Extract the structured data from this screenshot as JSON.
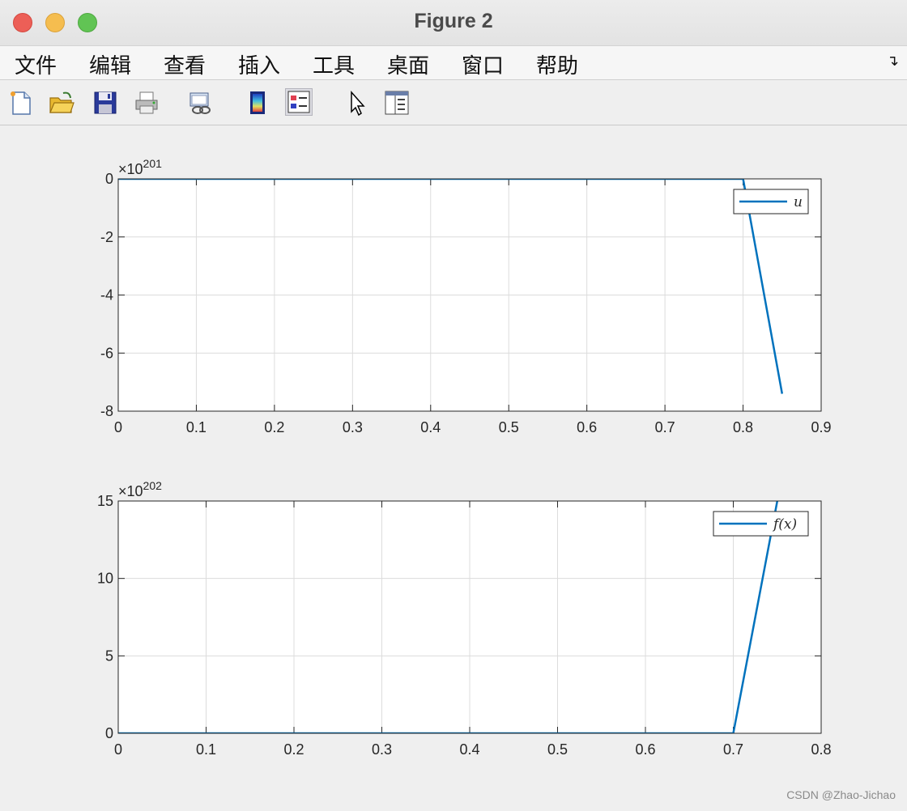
{
  "window": {
    "title": "Figure 2"
  },
  "menu": [
    "文件",
    "编辑",
    "查看",
    "插入",
    "工具",
    "桌面",
    "窗口",
    "帮助"
  ],
  "menu_overflow_icon": "overflow-arrow-icon",
  "toolbar": [
    "new-figure-icon",
    "open-file-icon",
    "save-icon",
    "print-icon",
    "link-plot-icon",
    "colorbar-icon",
    "legend-icon",
    "pointer-icon",
    "property-inspector-icon"
  ],
  "watermark": "CSDN @Zhao-Jichao",
  "colors": {
    "line": "#0072bd",
    "grid": "#dcdcdc",
    "bg": "#efefef"
  },
  "chart_data": [
    {
      "type": "line",
      "title": "",
      "xlabel": "",
      "ylabel": "",
      "exponent_label": "×10",
      "exponent": "201",
      "xlim": [
        0,
        0.9
      ],
      "ylim": [
        -8,
        0
      ],
      "xticks": [
        "0",
        "0.1",
        "0.2",
        "0.3",
        "0.4",
        "0.5",
        "0.6",
        "0.7",
        "0.8",
        "0.9"
      ],
      "yticks": [
        "0",
        "-2",
        "-4",
        "-6",
        "-8"
      ],
      "grid": true,
      "legend_position": "top-right",
      "series": [
        {
          "name": "u",
          "x": [
            0,
            0.1,
            0.2,
            0.3,
            0.4,
            0.5,
            0.6,
            0.7,
            0.8,
            0.85
          ],
          "y": [
            0,
            0,
            0,
            0,
            0,
            0,
            0,
            0,
            0,
            -7.4
          ]
        }
      ]
    },
    {
      "type": "line",
      "title": "",
      "xlabel": "",
      "ylabel": "",
      "exponent_label": "×10",
      "exponent": "202",
      "xlim": [
        0,
        0.8
      ],
      "ylim": [
        0,
        15
      ],
      "xticks": [
        "0",
        "0.1",
        "0.2",
        "0.3",
        "0.4",
        "0.5",
        "0.6",
        "0.7",
        "0.8"
      ],
      "yticks": [
        "15",
        "10",
        "5",
        "0"
      ],
      "grid": true,
      "legend_position": "top-right",
      "series": [
        {
          "name": "f(x)",
          "x": [
            0,
            0.1,
            0.2,
            0.3,
            0.4,
            0.5,
            0.6,
            0.7,
            0.75
          ],
          "y": [
            0,
            0,
            0,
            0,
            0,
            0,
            0,
            0,
            15
          ]
        }
      ]
    }
  ]
}
